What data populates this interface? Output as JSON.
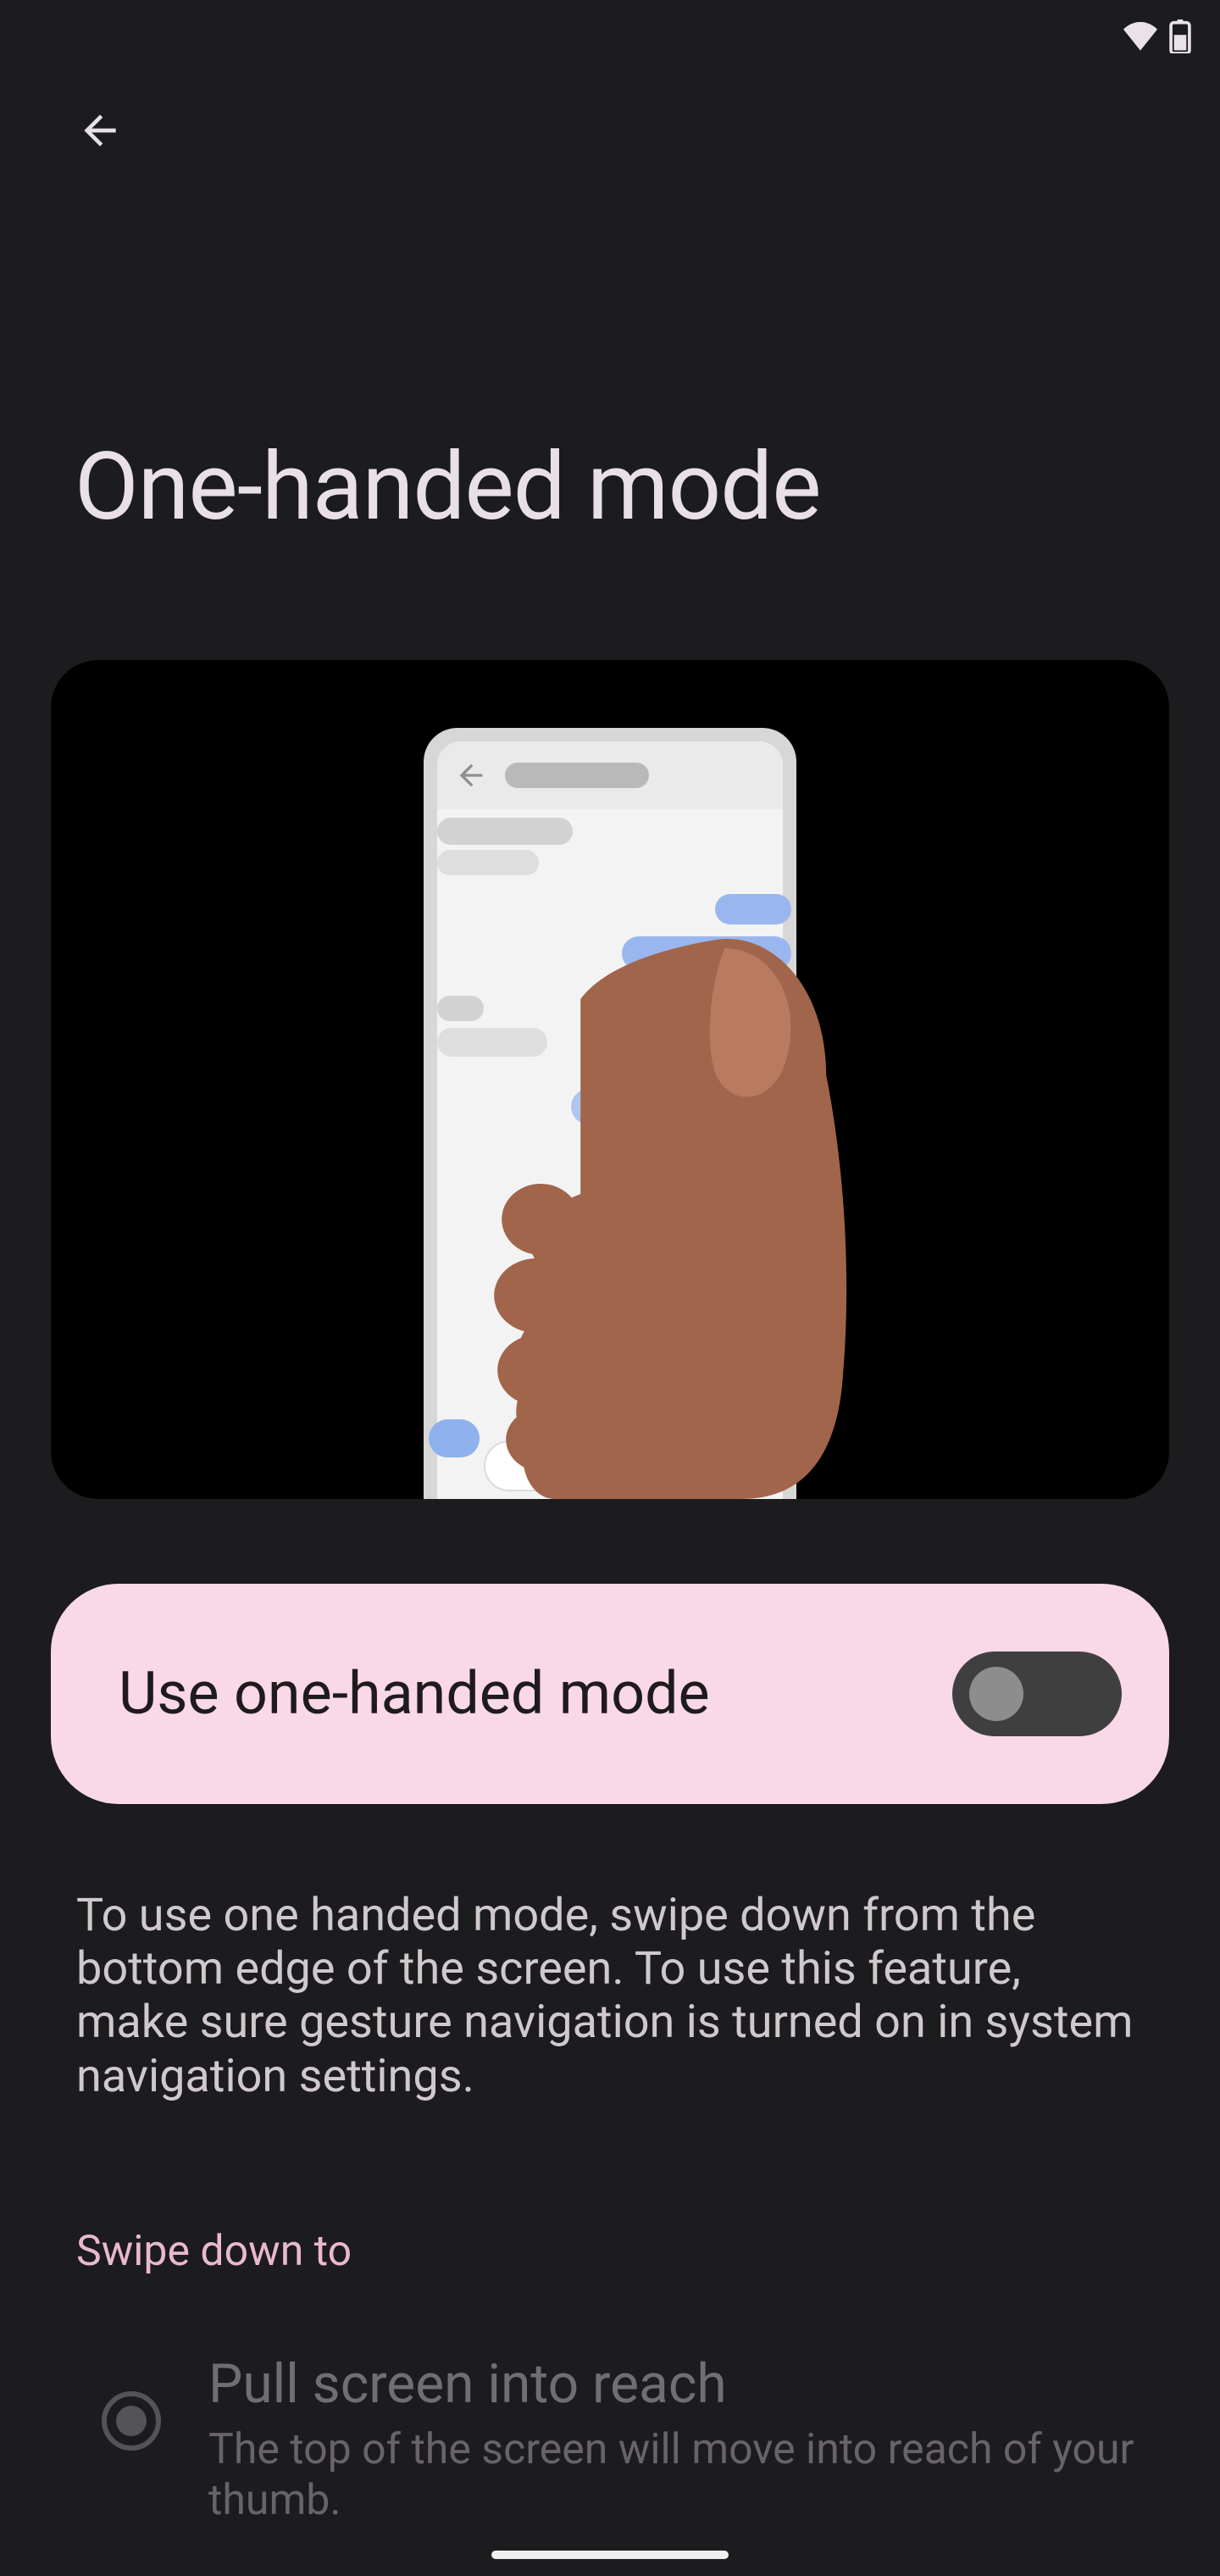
{
  "status": {
    "wifi_icon": "wifi-icon",
    "battery_icon": "battery-icon"
  },
  "title": "One-handed mode",
  "primary_toggle": {
    "label": "Use one-handed mode",
    "on": false
  },
  "description": "To use one handed mode, swipe down from the bottom edge of the screen. To use this feature, make sure gesture navigation is turned on in system navigation settings.",
  "section_header": "Swipe down to",
  "options": [
    {
      "selected": true,
      "enabled": false,
      "title": "Pull screen into reach",
      "subtitle": "The top of the screen will move into reach of your thumb."
    }
  ],
  "colors": {
    "accent_container": "#f9d8e7",
    "section_accent": "#e9b8cf"
  }
}
